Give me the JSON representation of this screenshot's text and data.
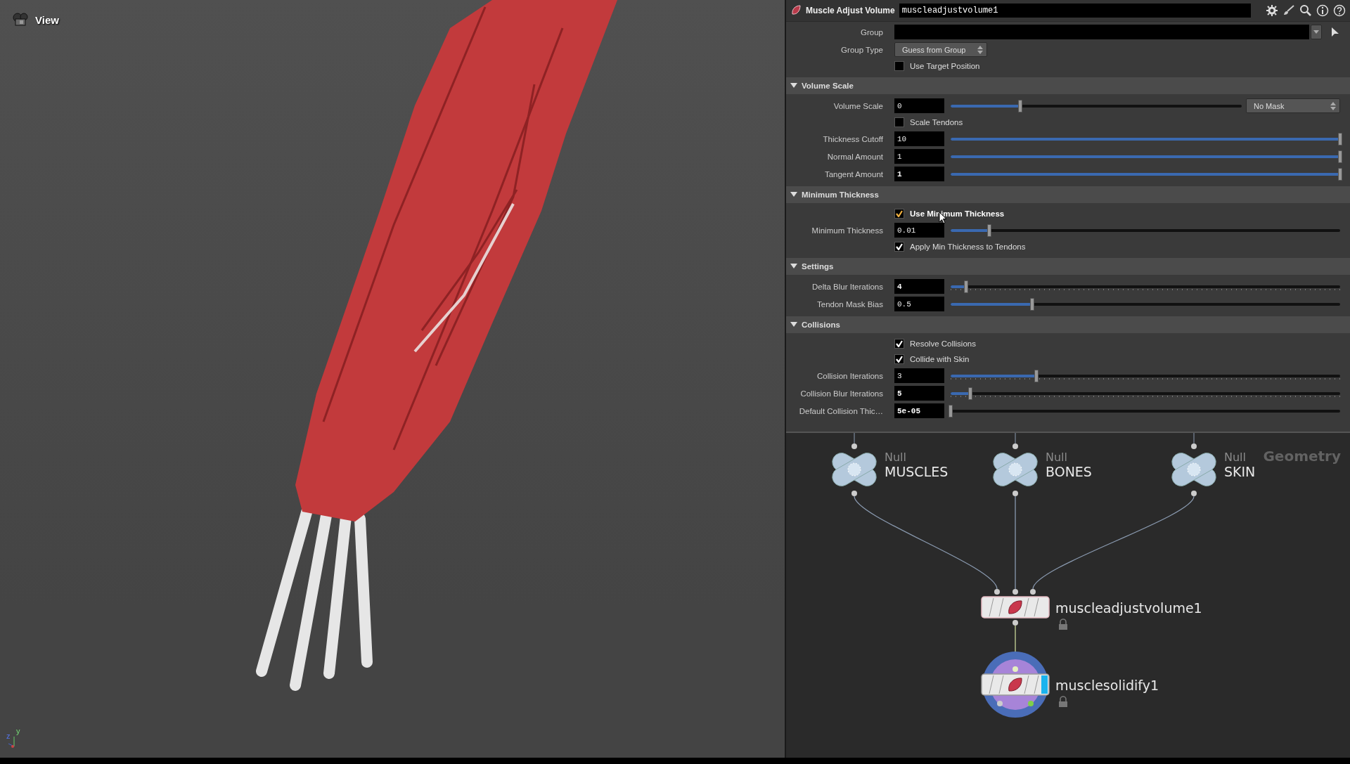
{
  "viewport": {
    "title": "View",
    "axes": [
      "y",
      "z"
    ]
  },
  "parameters": {
    "node_type": "Muscle Adjust Volume",
    "node_name": "muscleadjustvolume1",
    "general": [
      {
        "kind": "group",
        "label": "Group"
      },
      {
        "kind": "menu",
        "label": "Group Type",
        "value": "Guess from Group"
      },
      {
        "kind": "checkbox",
        "label": "Use Target Position",
        "checked": false,
        "hover": false
      }
    ],
    "sections": [
      {
        "title": "Volume Scale",
        "expanded": true,
        "rows": [
          {
            "kind": "slider",
            "label": "Volume Scale",
            "value": "0",
            "modified": false,
            "level": 0.24,
            "ticks": false,
            "menu": "No Mask"
          },
          {
            "kind": "checkbox",
            "label": "Scale Tendons",
            "checked": false,
            "hover": false
          },
          {
            "kind": "slider",
            "label": "Thickness Cutoff",
            "value": "10",
            "modified": false,
            "level": 1,
            "ticks": false
          },
          {
            "kind": "slider",
            "label": "Normal Amount",
            "value": "1",
            "modified": false,
            "level": 1,
            "ticks": false
          },
          {
            "kind": "slider",
            "label": "Tangent Amount",
            "value": "1",
            "modified": true,
            "level": 1,
            "ticks": false
          }
        ]
      },
      {
        "title": "Minimum Thickness",
        "expanded": true,
        "rows": [
          {
            "kind": "checkbox",
            "label": "Use Minimum Thickness",
            "checked": true,
            "hover": true
          },
          {
            "kind": "slider",
            "label": "Minimum Thickness",
            "value": "0.01",
            "modified": false,
            "level": 0.1,
            "ticks": false
          },
          {
            "kind": "checkbox",
            "label": "Apply Min Thickness to Tendons",
            "checked": true,
            "hover": false
          }
        ]
      },
      {
        "title": "Settings",
        "expanded": true,
        "rows": [
          {
            "kind": "slider",
            "label": "Delta Blur Iterations",
            "value": "4",
            "modified": true,
            "level": 0.04,
            "ticks": true
          },
          {
            "kind": "slider",
            "label": "Tendon Mask Bias",
            "value": "0.5",
            "modified": false,
            "level": 0.21,
            "ticks": false
          }
        ]
      },
      {
        "title": "Collisions",
        "expanded": true,
        "rows": [
          {
            "kind": "checkbox",
            "label": "Resolve Collisions",
            "checked": true,
            "hover": false
          },
          {
            "kind": "checkbox",
            "label": "Collide with Skin",
            "checked": true,
            "hover": false
          },
          {
            "kind": "slider",
            "label": "Collision Iterations",
            "value": "3",
            "modified": false,
            "level": 0.22,
            "ticks": true
          },
          {
            "kind": "slider",
            "label": "Collision Blur Iterations",
            "value": "5",
            "modified": true,
            "level": 0.05,
            "ticks": true
          },
          {
            "kind": "slider",
            "label": "Default Collision Thic…",
            "value": "5e-05",
            "modified": true,
            "level": 0,
            "ticks": false
          }
        ]
      }
    ]
  },
  "network": {
    "context": "Geometry",
    "nodes": [
      {
        "kind": "null",
        "type_label": "Null",
        "name": "MUSCLES"
      },
      {
        "kind": "null",
        "type_label": "Null",
        "name": "BONES"
      },
      {
        "kind": "null",
        "type_label": "Null",
        "name": "SKIN"
      },
      {
        "kind": "sop",
        "name": "muscleadjustvolume1",
        "display": false
      },
      {
        "kind": "sop",
        "name": "musclesolidify1",
        "display": true
      }
    ]
  }
}
